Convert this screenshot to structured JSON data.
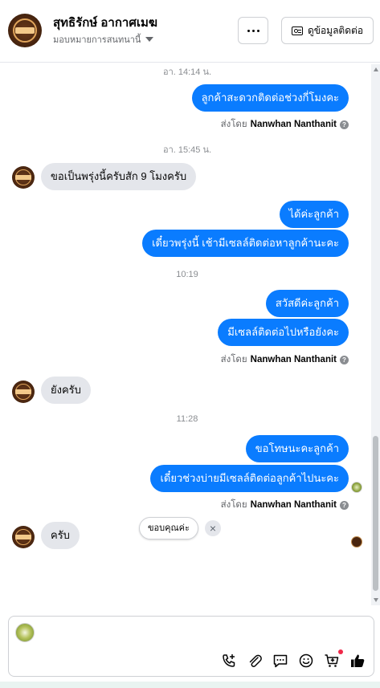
{
  "header": {
    "title": "สุทธิรักษ์ อากาศเมฆ",
    "subtitle": "มอบหมายการสนทนานี้",
    "more_label": "···",
    "contact_label": "ดูข้อมูลติดต่อ"
  },
  "messages": {
    "ts1": "อา. 14:14 น.",
    "m1": "ลูกค้าสะดวกติดต่อช่วงกี่โมงคะ",
    "sent1_prefix": "ส่งโดย",
    "sent1_name": "Nanwhan Nanthanit",
    "ts2": "อา. 15:45 น.",
    "m2": "ขอเป็นพรุ่งนี้ครับสัก 9  โมงครับ",
    "m3": "ได้ค่ะลูกค้า",
    "m4": "เดี๋ยวพรุ่งนี้ เช้ามีเซลล์ติดต่อหาลูกค้านะคะ",
    "ts3": "10:19",
    "m5": "สวัสดีค่ะลูกค้า",
    "m6": "มีเซลล์ติดต่อไปหรือยังคะ",
    "sent2_prefix": "ส่งโดย",
    "sent2_name": "Nanwhan Nanthanit",
    "m7": "ยังครับ",
    "ts4": "11:28",
    "m8": "ขอโทษนะคะลูกค้า",
    "m9": "เดี๋ยวช่วงบ่ายมีเซลล์ติดต่อลูกค้าไปนะคะ",
    "sent3_prefix": "ส่งโดย",
    "sent3_name": "Nanwhan Nanthanit",
    "m10": "ครับ"
  },
  "quick_reply": {
    "label": "ขอบคุณค่ะ",
    "dismiss": "×"
  },
  "composer": {
    "placeholder": "",
    "tools": [
      "call-add-icon",
      "attachment-icon",
      "saved-reply-icon",
      "emoji-icon",
      "cart-icon",
      "like-icon"
    ]
  },
  "colors": {
    "outgoing": "#0a7cff",
    "incoming": "#e4e6eb",
    "notification": "#f02849"
  }
}
